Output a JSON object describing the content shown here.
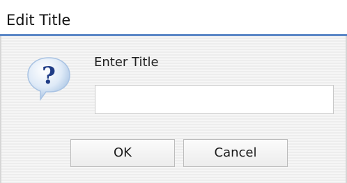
{
  "dialog": {
    "title": "Edit Title",
    "icon": "question-icon",
    "prompt_label": "Enter Title",
    "input": {
      "value": "",
      "placeholder": ""
    },
    "buttons": {
      "ok_label": "OK",
      "cancel_label": "Cancel"
    }
  },
  "colors": {
    "title_underline": "#5a86c6",
    "icon_bubble": "#c9dff7",
    "icon_glyph": "#1f3c86"
  }
}
